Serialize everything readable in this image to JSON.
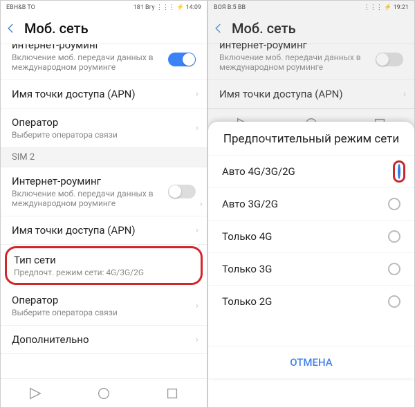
{
  "left": {
    "status_left": "ЕВН&В ТО",
    "status_right": "181 Вгу ⋮⋮⋮ ⚡ 14:09",
    "title": "Моб. сеть",
    "roaming_top": {
      "title": "интернет-роуминг",
      "desc": "Включение моб. передачи данных в международном роуминге"
    },
    "apn": "Имя точки доступа (APN)",
    "operator_label": "Оператор",
    "operator_sub": "Выберите оператора связи",
    "sim2": "SIM 2",
    "roaming2": {
      "title": "Интернет-роуминг",
      "desc": "Включение моб. передачи данных в международном роуминге"
    },
    "apn2": "Имя точки доступа (APN)",
    "net_type": "Тип сети",
    "net_type_sub": "Предпочт. режим сети: 4G/3G/2G",
    "operator2_label": "Оператор",
    "operator2_sub": "Выберите оператора связи",
    "additional": "Дополнительно"
  },
  "right": {
    "status_left": "ВОЯ В:5 ВВ",
    "status_right": "⋮⋮⋮ ⚡ 19:21",
    "title": "Моб. сеть",
    "roaming_top": {
      "title": "интернет-роуминг",
      "desc": "Включение моб. передачи данных в международном роуминге"
    },
    "apn": "Имя точки доступа (APN)",
    "dialog": {
      "title": "Предпочтительный режим сети",
      "options": [
        "Авто 4G/3G/2G",
        "Авто 3G/2G",
        "Только 4G",
        "Только 3G",
        "Только 2G"
      ],
      "selected": 0,
      "cancel": "ОТМЕНА"
    }
  }
}
